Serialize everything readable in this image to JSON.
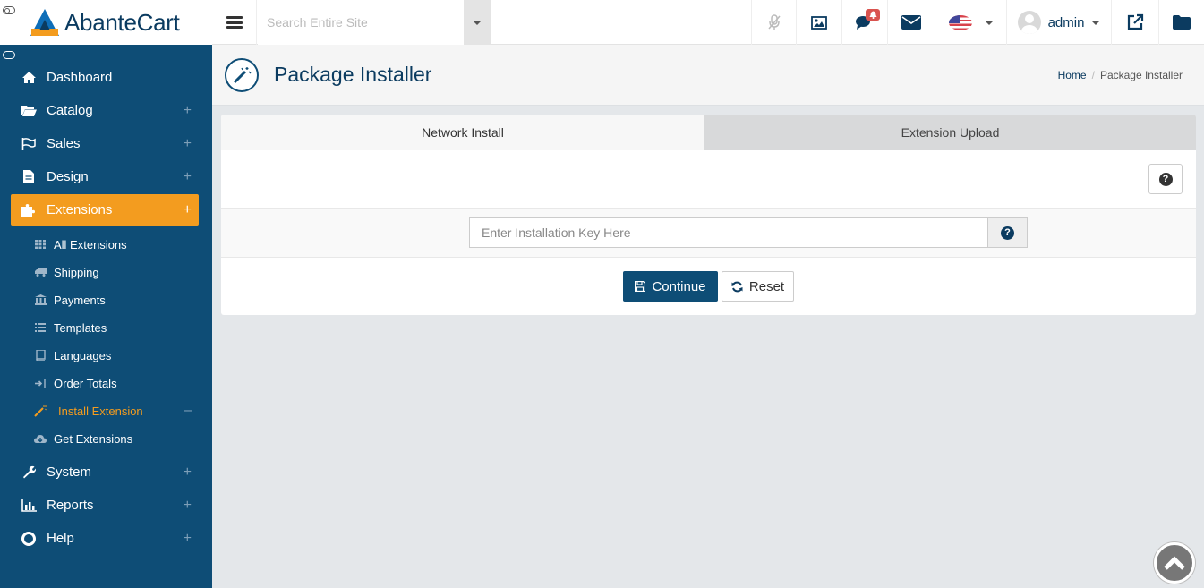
{
  "app": {
    "logo_text": "AbanteCart"
  },
  "topbar": {
    "search_placeholder": "Search Entire Site",
    "notification_count": "",
    "user_name": "admin"
  },
  "sidebar": {
    "items": [
      {
        "label": "Dashboard",
        "icon": "home-icon"
      },
      {
        "label": "Catalog",
        "icon": "folder-open-icon"
      },
      {
        "label": "Sales",
        "icon": "flag-icon"
      },
      {
        "label": "Design",
        "icon": "file-icon"
      },
      {
        "label": "Extensions",
        "icon": "puzzle-icon"
      },
      {
        "label": "System",
        "icon": "wrench-icon"
      },
      {
        "label": "Reports",
        "icon": "bar-chart-icon"
      },
      {
        "label": "Help",
        "icon": "life-ring-icon"
      }
    ],
    "sub_items": [
      {
        "label": "All Extensions",
        "icon": "grid-icon"
      },
      {
        "label": "Shipping",
        "icon": "truck-icon"
      },
      {
        "label": "Payments",
        "icon": "bank-icon"
      },
      {
        "label": "Templates",
        "icon": "list-icon"
      },
      {
        "label": "Languages",
        "icon": "book-icon"
      },
      {
        "label": "Order Totals",
        "icon": "sign-in-icon"
      },
      {
        "label": "Install Extension",
        "icon": "magic-wand-icon"
      },
      {
        "label": "Get Extensions",
        "icon": "cloud-download-icon"
      }
    ],
    "active_item": "Extensions",
    "active_sub_item": "Install Extension"
  },
  "page": {
    "title": "Package Installer",
    "breadcrumb": [
      "Home",
      "Package Installer"
    ]
  },
  "panel": {
    "tabs": [
      "Network Install",
      "Extension Upload"
    ],
    "active_tab": "Network Install",
    "key_input_placeholder": "Enter Installation Key Here",
    "continue_label": "Continue",
    "reset_label": "Reset"
  },
  "colors": {
    "sidebar_bg": "#0e4d76",
    "accent": "#f39c1f",
    "primary": "#0b3b60"
  }
}
